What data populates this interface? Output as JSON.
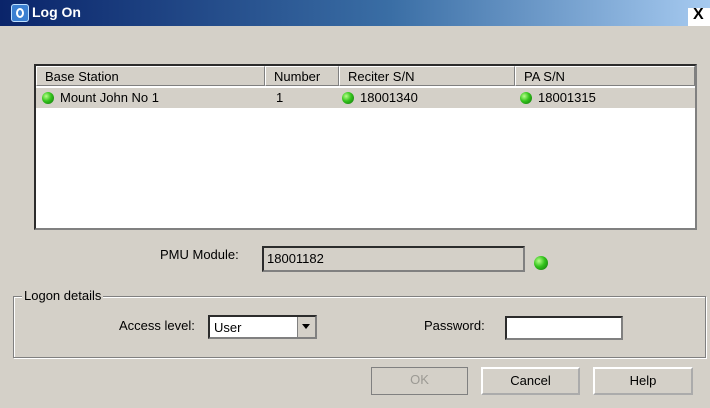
{
  "window": {
    "title": "Log On",
    "close_label": "X"
  },
  "list": {
    "columns": [
      "Base Station",
      "Number",
      "Reciter S/N",
      "PA S/N"
    ],
    "rows": [
      {
        "base_station": "Mount John No 1",
        "number": "1",
        "reciter_sn": "18001340",
        "pa_sn": "18001315"
      }
    ],
    "status_color": "#32c31b"
  },
  "pmu": {
    "label": "PMU Module:",
    "value": "18001182"
  },
  "logon": {
    "group_title": "Logon details",
    "access_label": "Access level:",
    "access_value": "User",
    "password_label": "Password:"
  },
  "buttons": {
    "ok": "OK",
    "cancel": "Cancel",
    "help": "Help"
  }
}
